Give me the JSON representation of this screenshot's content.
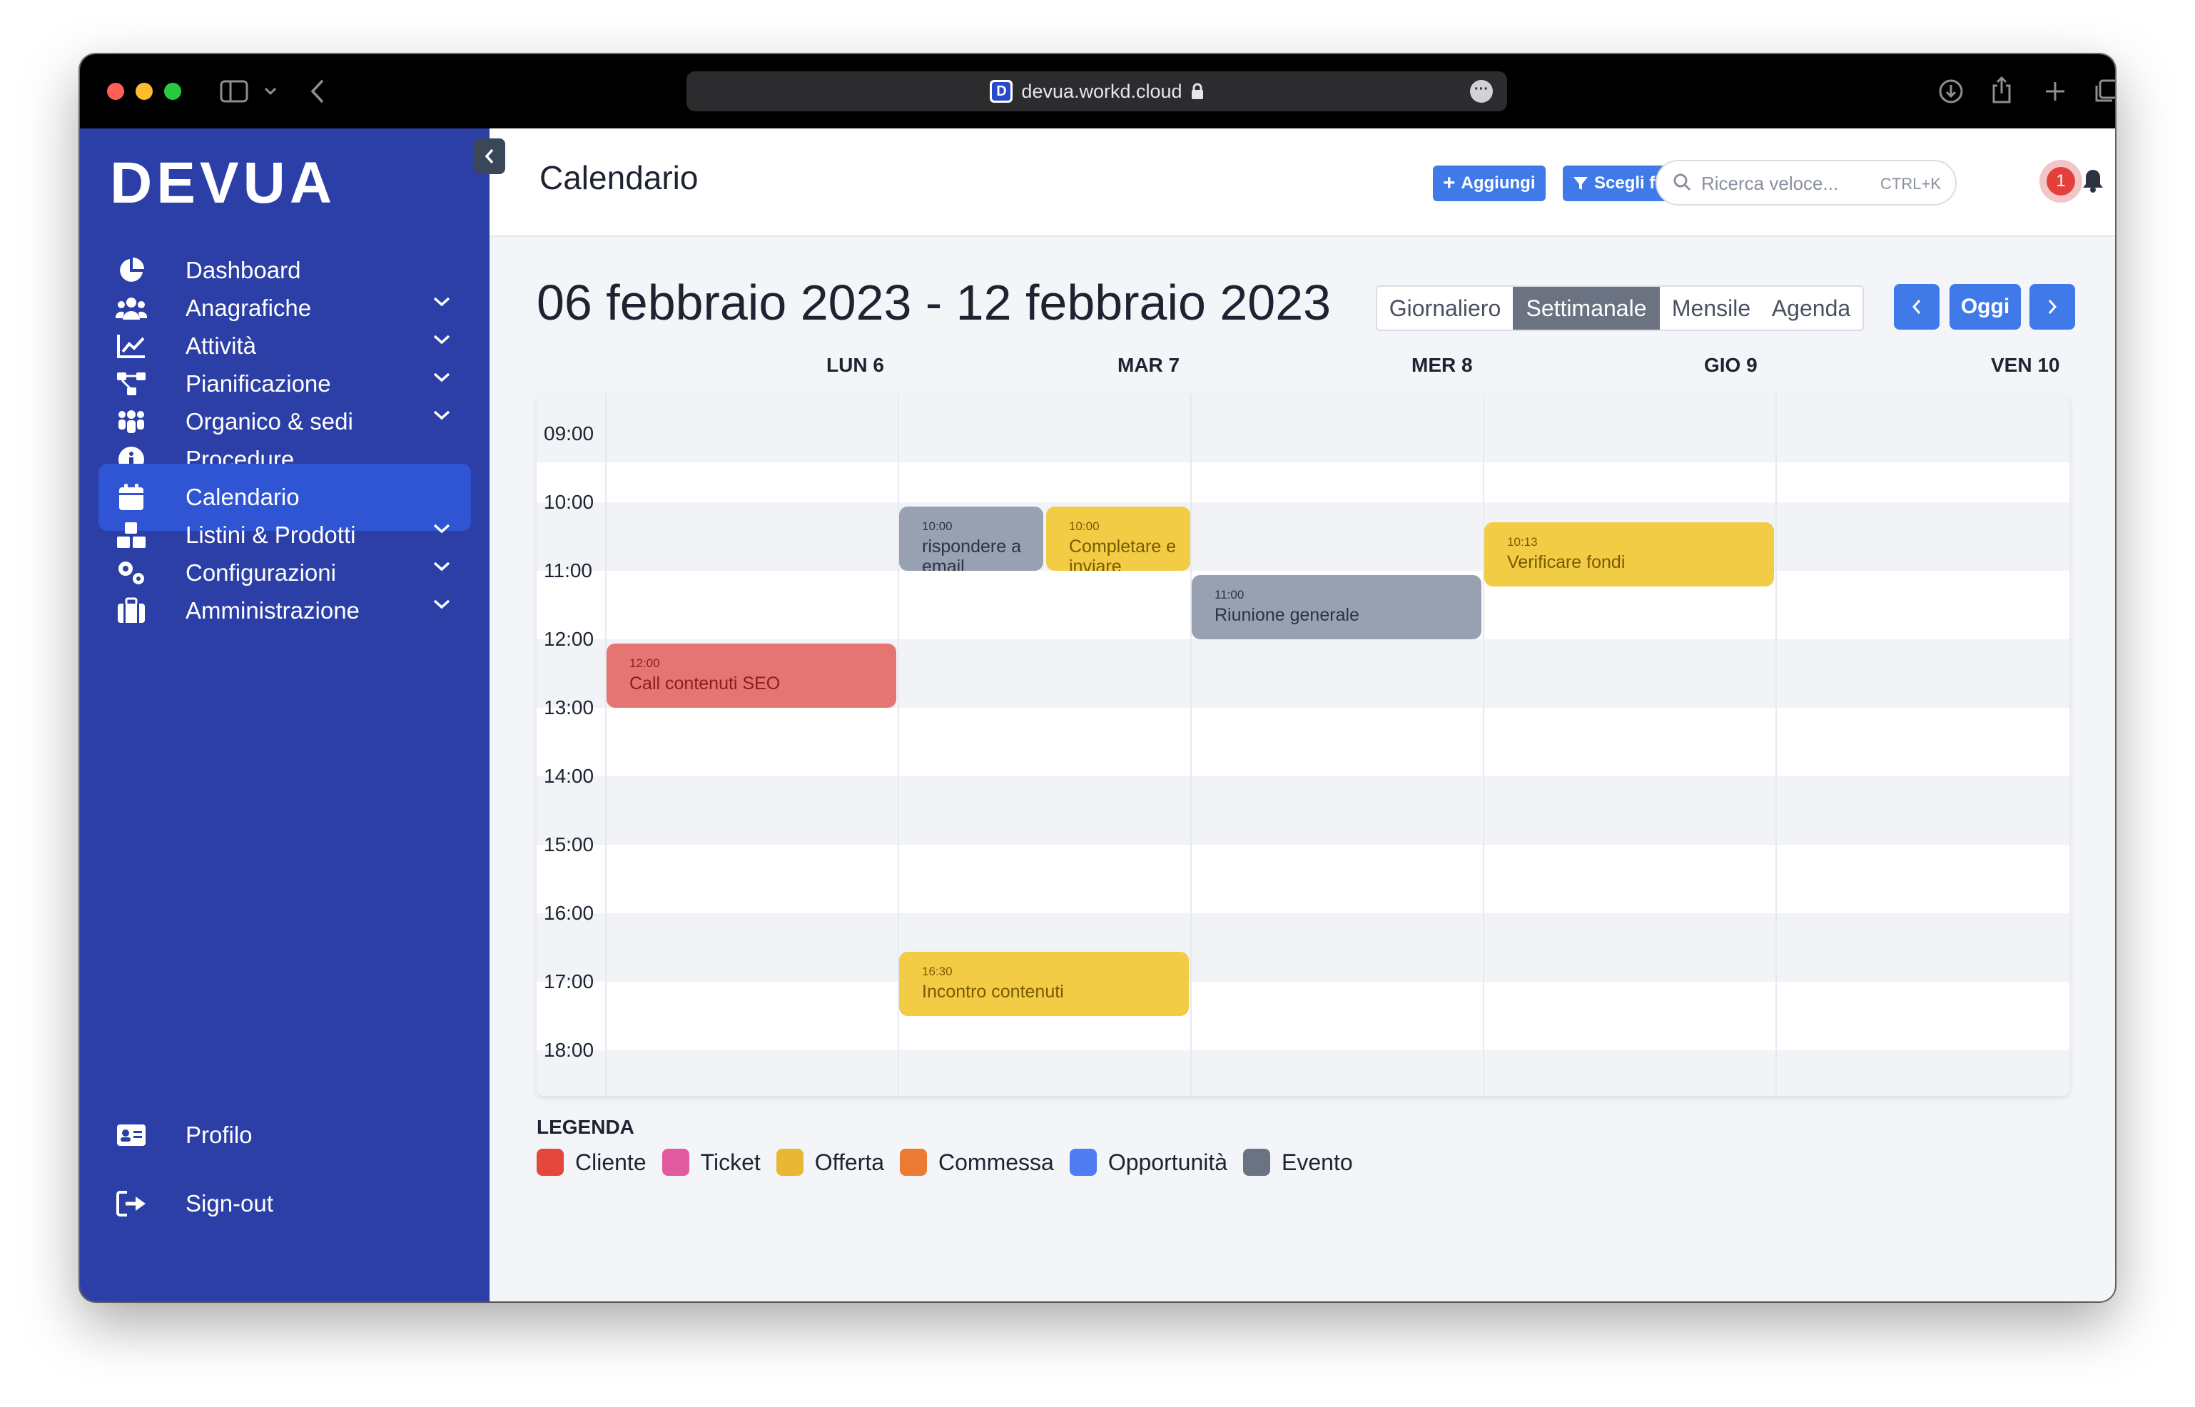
{
  "browser": {
    "url": "devua.workd.cloud",
    "favicon_letter": "D"
  },
  "sidebar": {
    "logo": "DEVUA",
    "items": [
      {
        "label": "Dashboard"
      },
      {
        "label": "Anagrafiche"
      },
      {
        "label": "Attività"
      },
      {
        "label": "Pianificazione"
      },
      {
        "label": "Organico & sedi"
      },
      {
        "label": "Procedure"
      },
      {
        "label": "Calendario"
      },
      {
        "label": "Listini & Prodotti"
      },
      {
        "label": "Configurazioni"
      },
      {
        "label": "Amministrazione"
      }
    ],
    "bottom": [
      {
        "label": "Profilo"
      },
      {
        "label": "Sign-out"
      }
    ]
  },
  "header": {
    "title": "Calendario",
    "add_label": "Aggiungi",
    "filter_label": "Scegli filtri",
    "search_placeholder": "Ricerca veloce...",
    "search_shortcut": "CTRL+K",
    "notification_count": "1"
  },
  "calendar": {
    "range_title": "06 febbraio 2023 - 12 febbraio 2023",
    "views": [
      {
        "label": "Giornaliero"
      },
      {
        "label": "Settimanale"
      },
      {
        "label": "Mensile"
      },
      {
        "label": "Agenda"
      }
    ],
    "active_view": "Settimanale",
    "today_label": "Oggi",
    "days": [
      "LUN 6",
      "MAR 7",
      "MER 8",
      "GIO 9",
      "VEN 10"
    ],
    "hours": [
      "09:00",
      "10:00",
      "11:00",
      "12:00",
      "13:00",
      "14:00",
      "15:00",
      "16:00",
      "17:00",
      "18:00"
    ],
    "events": [
      {
        "time": "10:00",
        "title": "rispondere a email",
        "day": "MAR 7",
        "type": "Evento"
      },
      {
        "time": "10:00",
        "title": "Completare e inviare",
        "day": "MAR 7",
        "type": "Offerta"
      },
      {
        "time": "11:00",
        "title": "Riunione generale",
        "day": "MER 8",
        "type": "Evento"
      },
      {
        "time": "10:13",
        "title": "Verificare fondi",
        "day": "GIO 9",
        "type": "Offerta"
      },
      {
        "time": "12:00",
        "title": "Call contenuti SEO",
        "day": "LUN 6",
        "type": "Cliente"
      },
      {
        "time": "16:30",
        "title": "Incontro contenuti",
        "day": "MAR 7",
        "type": "Offerta"
      }
    ]
  },
  "legend": {
    "title": "LEGENDA",
    "items": [
      {
        "label": "Cliente",
        "color": "#e4473c"
      },
      {
        "label": "Ticket",
        "color": "#e25aa0"
      },
      {
        "label": "Offerta",
        "color": "#e8b835"
      },
      {
        "label": "Commessa",
        "color": "#ec7a32"
      },
      {
        "label": "Opportunità",
        "color": "#4f7cf0"
      },
      {
        "label": "Evento",
        "color": "#6b7282"
      }
    ]
  }
}
